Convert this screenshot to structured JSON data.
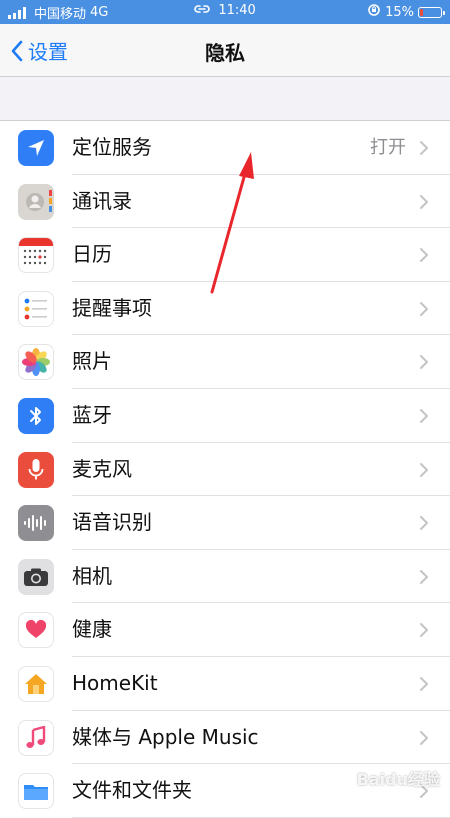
{
  "status_bar": {
    "carrier": "中国移动",
    "network": "4G",
    "time": "11:40",
    "battery_percent": "15%"
  },
  "nav": {
    "back_label": "设置",
    "title": "隐私"
  },
  "rows": [
    {
      "label": "定位服务",
      "value": "打开",
      "icon": "location-arrow-icon"
    },
    {
      "label": "通讯录",
      "value": "",
      "icon": "contacts-icon"
    },
    {
      "label": "日历",
      "value": "",
      "icon": "calendar-icon"
    },
    {
      "label": "提醒事项",
      "value": "",
      "icon": "reminders-icon"
    },
    {
      "label": "照片",
      "value": "",
      "icon": "photos-icon"
    },
    {
      "label": "蓝牙",
      "value": "",
      "icon": "bluetooth-icon"
    },
    {
      "label": "麦克风",
      "value": "",
      "icon": "microphone-icon"
    },
    {
      "label": "语音识别",
      "value": "",
      "icon": "speech-recognition-icon"
    },
    {
      "label": "相机",
      "value": "",
      "icon": "camera-icon"
    },
    {
      "label": "健康",
      "value": "",
      "icon": "health-heart-icon"
    },
    {
      "label": "HomeKit",
      "value": "",
      "icon": "home-icon"
    },
    {
      "label": "媒体与 Apple Music",
      "value": "",
      "icon": "music-note-icon"
    },
    {
      "label": "文件和文件夹",
      "value": "",
      "icon": "folder-icon"
    }
  ],
  "watermark": "Baidu经验",
  "colors": {
    "accent": "#1f7cf7",
    "status_bar": "#4a90e2",
    "annotation_arrow": "#e8262c"
  }
}
